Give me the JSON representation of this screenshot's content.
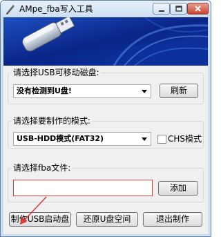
{
  "window": {
    "title": "AMpe_fba写入工具"
  },
  "usb_group": {
    "label": "请选择USB可移动磁盘:",
    "disk_select_value": "没有检测到U盘!",
    "refresh_label": "刷新"
  },
  "mode_group": {
    "label": "请选择要制作的模式:",
    "mode_select_value": "USB-HDD模式(FAT32)",
    "chs_label": "CHS模式"
  },
  "fba_group": {
    "label": "请选择fba文件:",
    "file_value": "",
    "add_label": "添加"
  },
  "actions": {
    "make_label": "制作USB启动盘",
    "restore_label": "还原U盘空间",
    "exit_label": "退出制作"
  },
  "colors": {
    "annotation": "#e03a3a",
    "title_bar": "#cddff3",
    "banner": "#0b2a8f"
  }
}
